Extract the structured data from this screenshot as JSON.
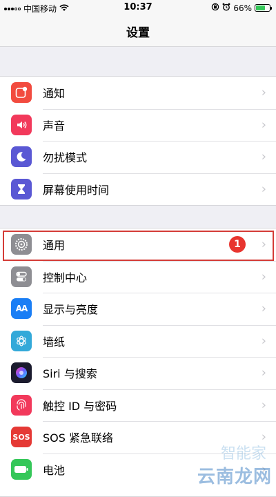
{
  "status_bar": {
    "carrier": "中国移动",
    "time": "10:37",
    "battery_percent": "66%",
    "battery_level": 0.66,
    "icons": [
      "signal-icon",
      "wifi-icon",
      "orientation-lock-icon",
      "alarm-icon",
      "battery-icon"
    ]
  },
  "nav": {
    "title": "设置"
  },
  "group1": [
    {
      "label": "通知",
      "icon": "notifications-icon",
      "color": "#f24b3f"
    },
    {
      "label": "声音",
      "icon": "sounds-icon",
      "color": "#f2395b"
    },
    {
      "label": "勿扰模式",
      "icon": "do-not-disturb-icon",
      "color": "#5a58d4"
    },
    {
      "label": "屏幕使用时间",
      "icon": "screen-time-icon",
      "color": "#5a58d4"
    }
  ],
  "group2": [
    {
      "label": "通用",
      "icon": "general-gear-icon",
      "color": "#8e8e93",
      "badge": "1"
    },
    {
      "label": "控制中心",
      "icon": "control-center-icon",
      "color": "#8e8e93"
    },
    {
      "label": "显示与亮度",
      "icon": "display-brightness-icon",
      "color": "#1a7ef5",
      "glyph": "AA"
    },
    {
      "label": "墙纸",
      "icon": "wallpaper-icon",
      "color": "#33a9d9"
    },
    {
      "label": "Siri 与搜索",
      "icon": "siri-icon",
      "color": "#1b1b2e"
    },
    {
      "label": "触控 ID 与密码",
      "icon": "touch-id-icon",
      "color": "#f2395b"
    },
    {
      "label": "SOS 紧急联络",
      "icon": "sos-icon",
      "color": "#e53935",
      "glyph": "SOS"
    },
    {
      "label": "电池",
      "icon": "battery-settings-icon",
      "color": "#35c759"
    }
  ],
  "watermark": {
    "text1": "智能家",
    "text2": "云南龙网"
  }
}
